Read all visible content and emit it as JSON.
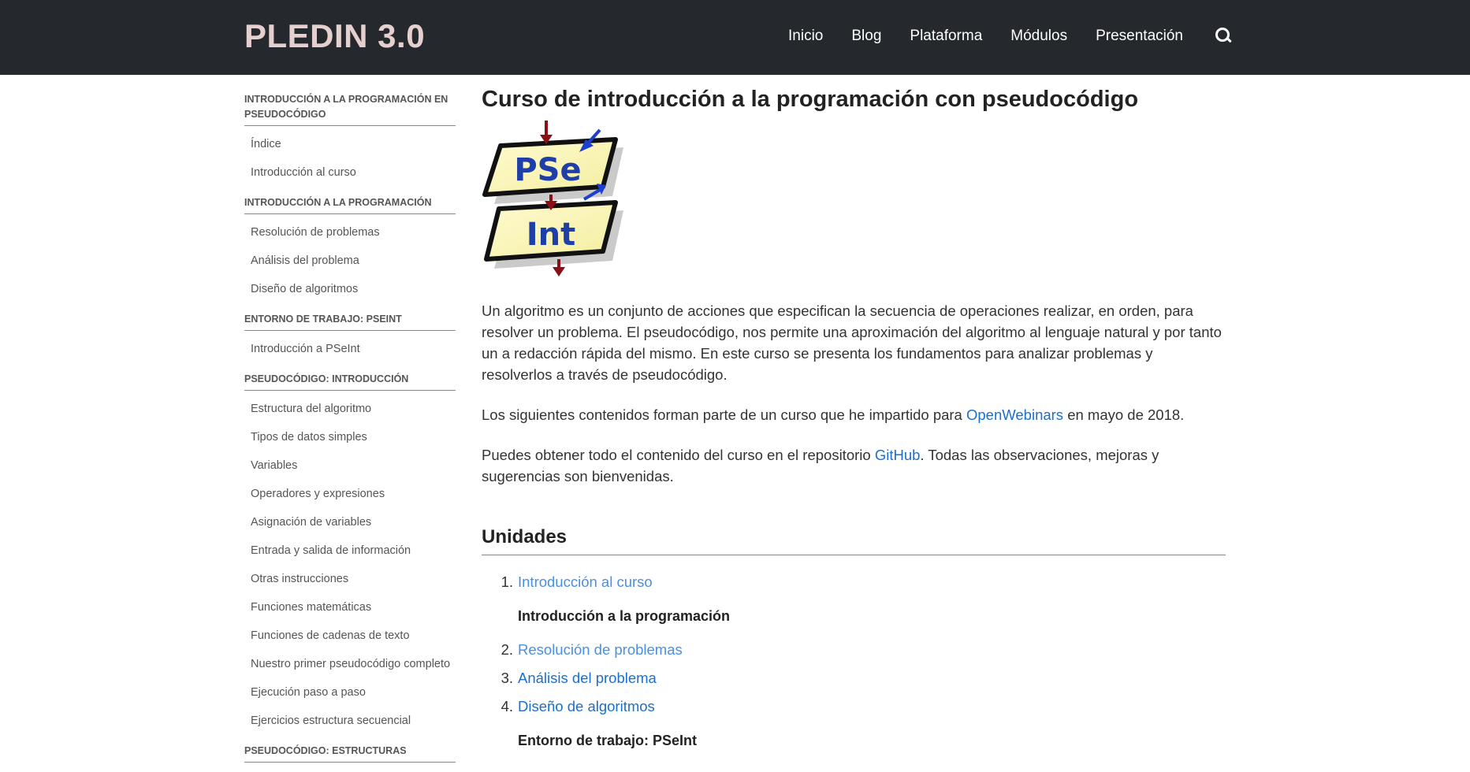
{
  "header": {
    "brand": "PLEDIN 3.0",
    "nav": [
      "Inicio",
      "Blog",
      "Plataforma",
      "Módulos",
      "Presentación"
    ],
    "search_icon": "search-icon"
  },
  "sidebar": {
    "sections": [
      {
        "title": "INTRODUCCIÓN A LA PROGRAMACIÓN EN PSEUDOCÓDIGO",
        "items": [
          "Índice",
          "Introducción al curso"
        ]
      },
      {
        "title": "INTRODUCCIÓN A LA PROGRAMACIÓN",
        "items": [
          "Resolución de problemas",
          "Análisis del problema",
          "Diseño de algoritmos"
        ]
      },
      {
        "title": "ENTORNO DE TRABAJO: PSEINT",
        "items": [
          "Introducción a PSeInt"
        ]
      },
      {
        "title": "PSEUDOCÓDIGO: INTRODUCCIÓN",
        "items": [
          "Estructura del algoritmo",
          "Tipos de datos simples",
          "Variables",
          "Operadores y expresiones",
          "Asignación de variables",
          "Entrada y salida de información",
          "Otras instrucciones",
          "Funciones matemáticas",
          "Funciones de cadenas de texto",
          "Nuestro primer pseudocódigo completo",
          "Ejecución paso a paso",
          "Ejercicios estructura secuencial"
        ]
      },
      {
        "title": "PSEUDOCÓDIGO: ESTRUCTURAS",
        "items": []
      }
    ]
  },
  "main": {
    "title": "Curso de introducción a la programación con pseudocódigo",
    "logo_top": "PSe",
    "logo_bottom": "Int",
    "para1": "Un algoritmo es un conjunto de acciones que especifican la secuencia de operaciones realizar, en orden, para resolver un problema. El pseudocódigo, nos permite una aproximación del algoritmo al lenguaje natural y por tanto un a redacción rápida del mismo. En este curso se presenta los fundamentos para analizar problemas y resolverlos a través de pseudocódigo.",
    "para2_before": "Los siguientes contenidos forman parte de un curso que he impartido para ",
    "para2_link": "OpenWebinars",
    "para2_after": " en mayo de 2018.",
    "para3_before": "Puedes obtener todo el contenido del curso en el repositorio ",
    "para3_link": "GitHub",
    "para3_after": ". Todas las observaciones, mejoras y sugerencias son bienvenidas.",
    "units_heading": "Unidades",
    "units": {
      "u1_num": "1.",
      "u1": "Introducción al curso",
      "group1": "Introducción a la programación",
      "u2_num": "2.",
      "u2": "Resolución de problemas",
      "u3_num": "3.",
      "u3": "Análisis del problema",
      "u4_num": "4.",
      "u4": "Diseño de algoritmos",
      "group2": "Entorno de trabajo: PSeInt"
    }
  },
  "colors": {
    "header_bg": "#25292d",
    "brand": "#e6cfcf",
    "link": "#1b6fce",
    "link_light": "#4a8fe0"
  }
}
